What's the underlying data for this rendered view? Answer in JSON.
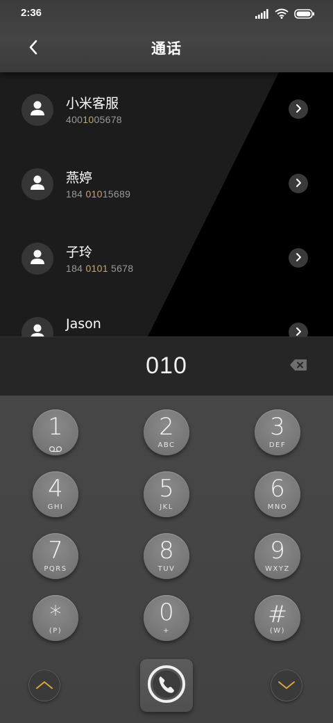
{
  "status_bar": {
    "time": "2:36"
  },
  "header": {
    "title": "通话"
  },
  "contacts": [
    {
      "name": "小米客服",
      "number_parts": [
        "400",
        "10",
        "05678"
      ]
    },
    {
      "name": "燕婷",
      "number_parts": [
        "184 ",
        "010",
        "15689"
      ]
    },
    {
      "name": "子玲",
      "number_parts": [
        "184 ",
        "0101",
        " 5678"
      ]
    },
    {
      "name": "Jason",
      "number_parts": [
        "",
        "",
        ""
      ]
    }
  ],
  "dial": {
    "value": "010"
  },
  "keypad": {
    "keys": [
      {
        "digit": "1",
        "letters": ""
      },
      {
        "digit": "2",
        "letters": "ABC"
      },
      {
        "digit": "3",
        "letters": "DEF"
      },
      {
        "digit": "4",
        "letters": "GHI"
      },
      {
        "digit": "5",
        "letters": "JKL"
      },
      {
        "digit": "6",
        "letters": "MNO"
      },
      {
        "digit": "7",
        "letters": "PQRS"
      },
      {
        "digit": "8",
        "letters": "TUV"
      },
      {
        "digit": "9",
        "letters": "WXYZ"
      },
      {
        "digit": "*",
        "letters": "(P)"
      },
      {
        "digit": "0",
        "letters": "+"
      },
      {
        "digit": "#",
        "letters": "(W)"
      }
    ]
  },
  "colors": {
    "match_highlight": "#c9a66b",
    "accent_gold": "#d9a63a"
  },
  "icons": {
    "back": "chevron-left-icon",
    "voicemail": "voicemail-icon",
    "backspace": "backspace-icon",
    "call": "phone-icon",
    "collapse": "chevron-up-icon",
    "expand": "chevron-down-icon"
  }
}
